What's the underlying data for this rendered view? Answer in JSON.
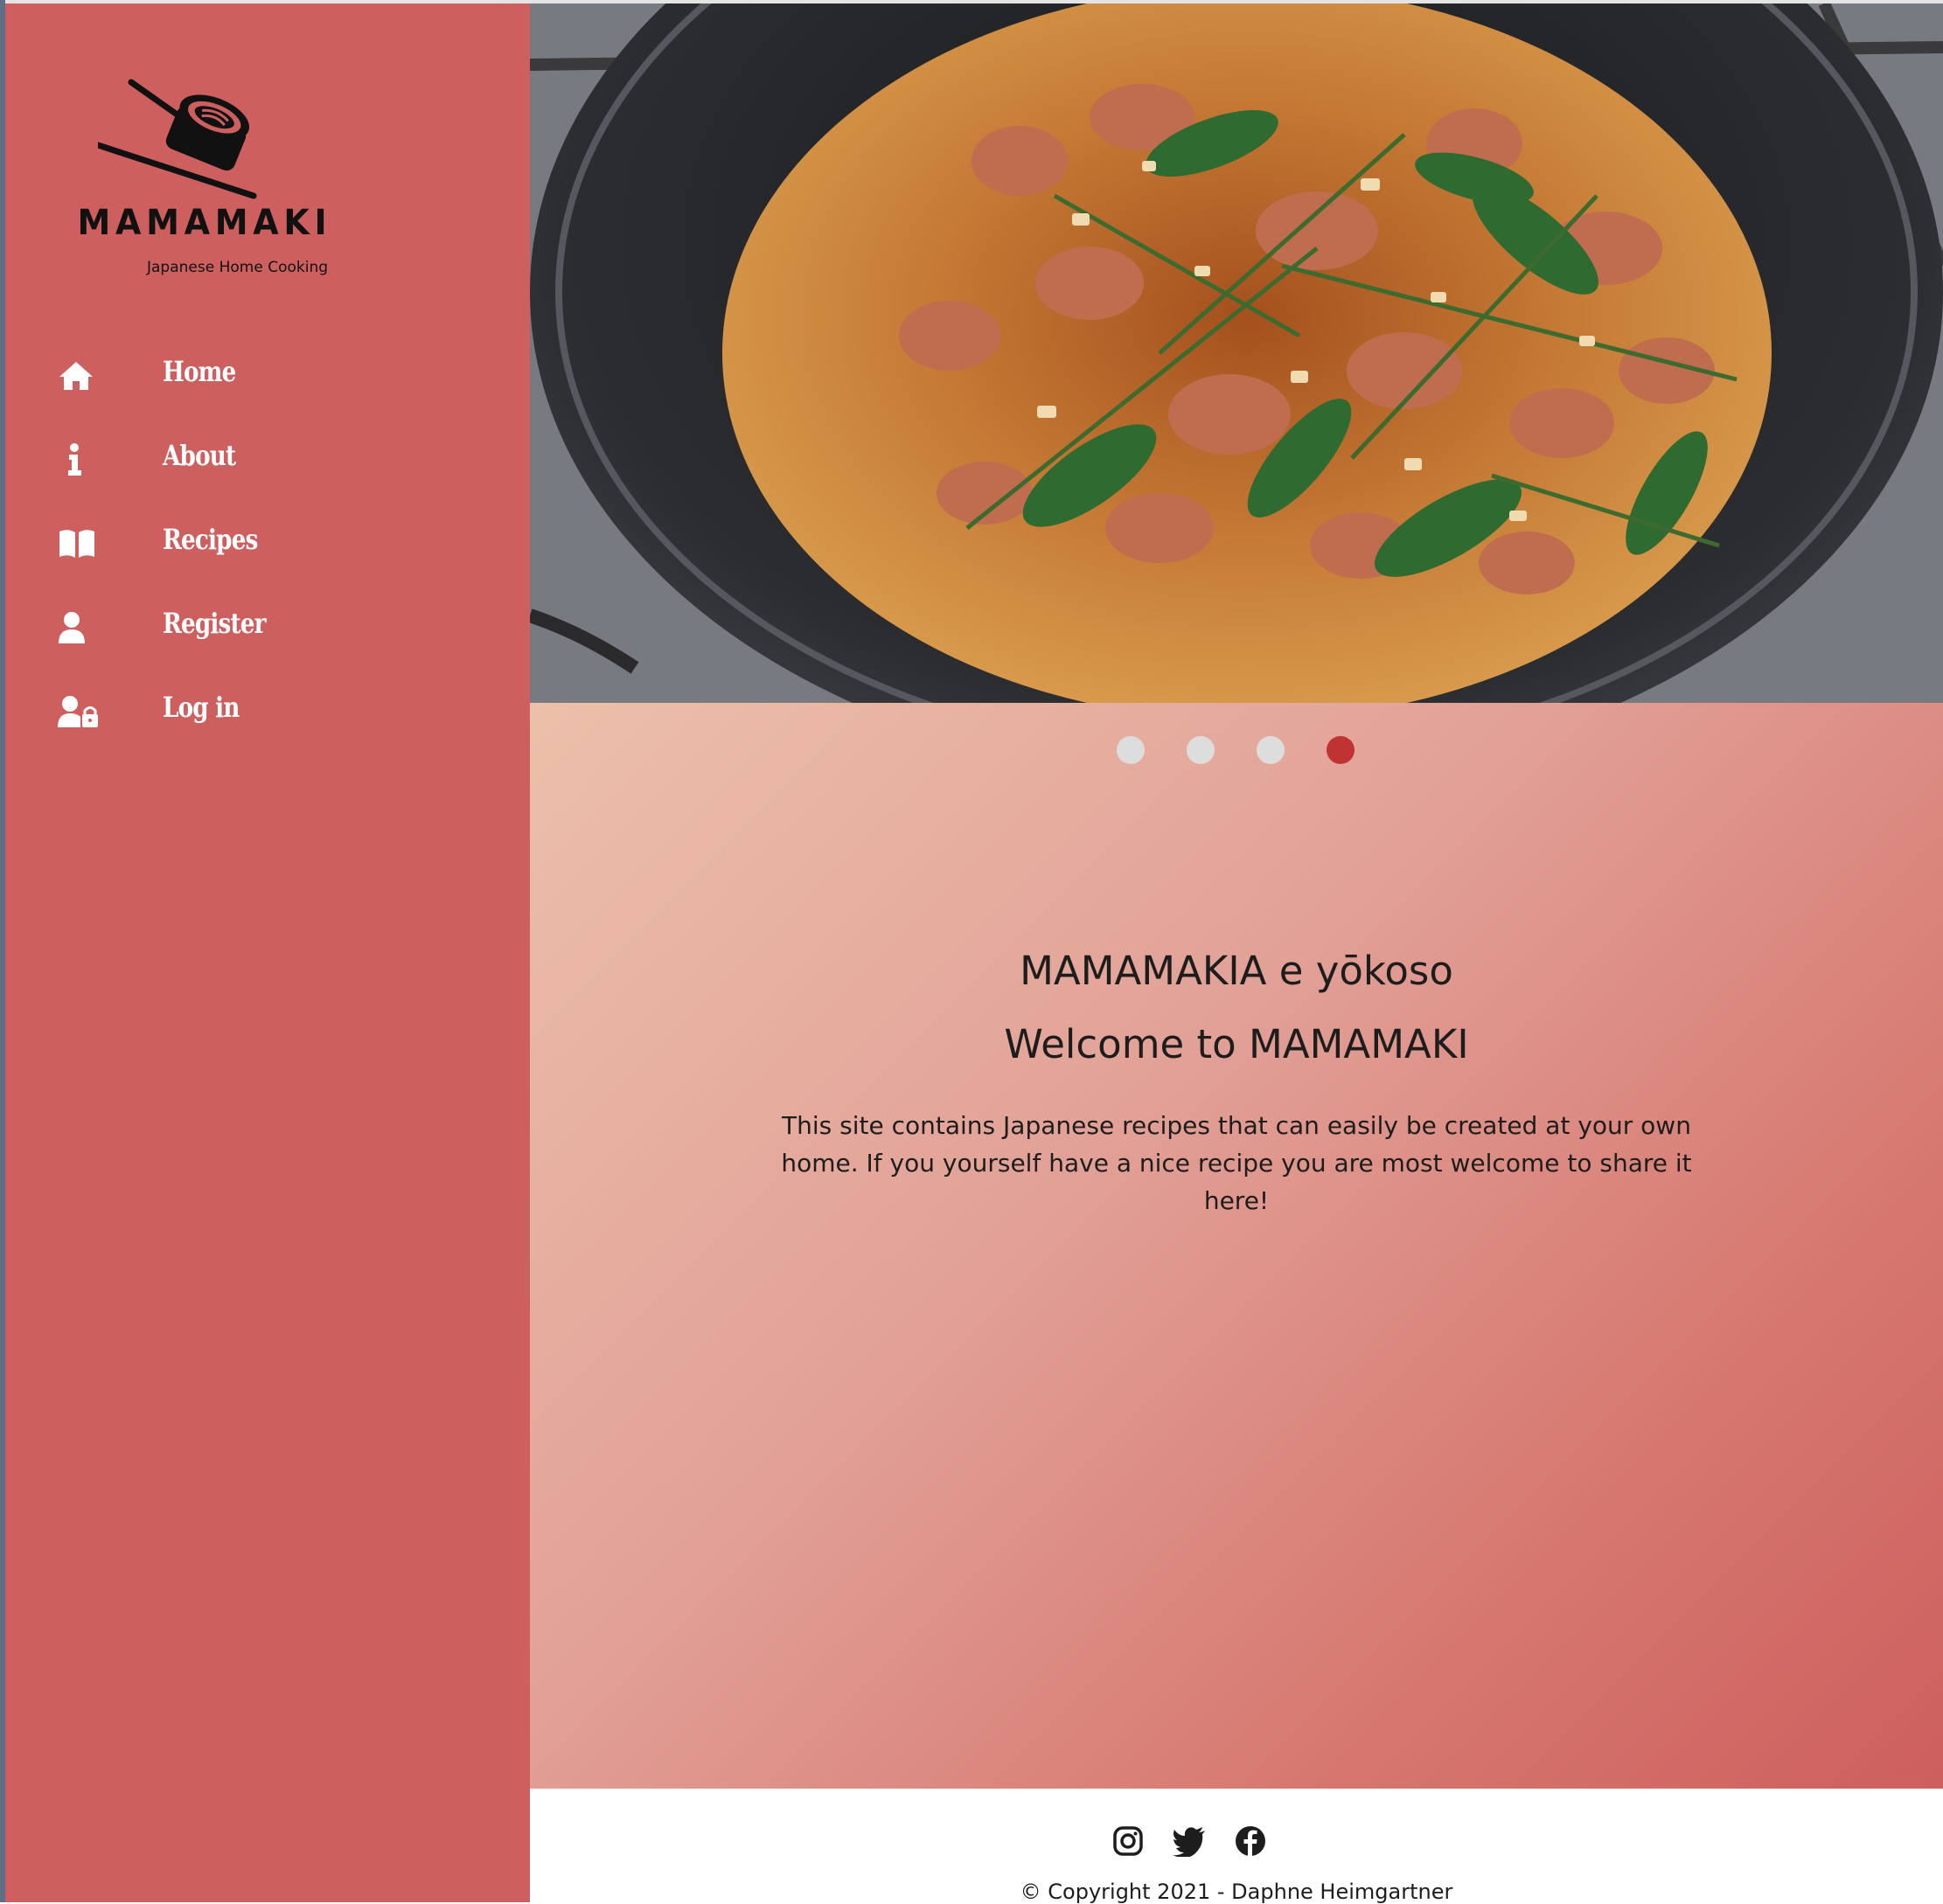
{
  "brand": {
    "name": "MAMAMAKI",
    "tagline": "Japanese Home Cooking",
    "logo_icon": "sushi-chopsticks-icon"
  },
  "nav": {
    "items": [
      {
        "label": "Home",
        "icon": "home-icon"
      },
      {
        "label": "About",
        "icon": "info-icon"
      },
      {
        "label": "Recipes",
        "icon": "book-icon"
      },
      {
        "label": "Register",
        "icon": "user-icon"
      },
      {
        "label": "Log in",
        "icon": "user-lock-icon"
      }
    ]
  },
  "carousel": {
    "slide_count": 4,
    "active_index": 3,
    "image_description": "stir-fried chicken with basil and rosemary in a wok"
  },
  "main": {
    "heading_jp": "MAMAMAKIA e yōkoso",
    "heading_en": "Welcome to MAMAMAKI",
    "intro": "This site contains Japanese recipes that can easily be created at your own home. If you yourself have a nice recipe you are most welcome to share it here!"
  },
  "footer": {
    "social": [
      "instagram-icon",
      "twitter-icon",
      "facebook-icon"
    ],
    "copyright": "© Copyright 2021 - Daphne Heimgartner"
  },
  "colors": {
    "sidebar": "#cd5f5f",
    "accent": "#bf3333",
    "dot_inactive": "#dddddd",
    "text": "#1d1d1d"
  }
}
